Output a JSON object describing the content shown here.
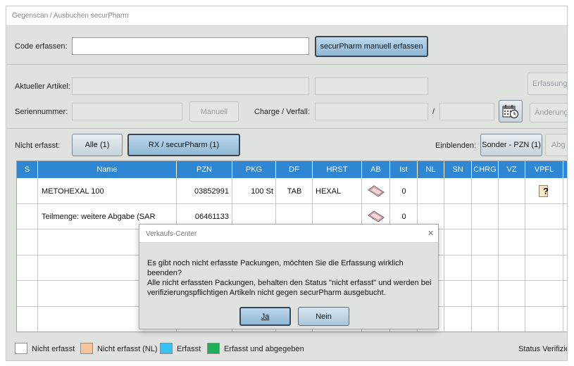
{
  "window": {
    "title": "Gegenscan / Ausbuchen securPharm"
  },
  "code": {
    "label": "Code erfassen:",
    "value": "",
    "manual_button": "securPharm manuell erfassen"
  },
  "artikel": {
    "label": "Aktueller Artikel:",
    "erfassung_button": "Erfassung"
  },
  "serien": {
    "label": "Seriennummer:",
    "manuell_button": "Manuell",
    "charge_label": "Charge / Verfall:",
    "slash": "/",
    "aenderung_button": "Änderung"
  },
  "filter": {
    "label": "Nicht erfasst:",
    "alle_button": "Alle (1)",
    "rx_button": "RX / securPharm (1)",
    "einblenden_label": "Einblenden:",
    "sonder_button": "Sonder - PZN (1)",
    "abg_button": "Abg"
  },
  "grid": {
    "columns": [
      "S",
      "Name",
      "PZN",
      "PKG",
      "DF",
      "HRST",
      "AB",
      "Ist",
      "NL",
      "SN",
      "CHRG",
      "VZ",
      "VPFL"
    ],
    "rows": [
      {
        "name": "METOHEXAL 100",
        "pzn": "03852991",
        "pkg": "100 St",
        "df": "TAB",
        "hrst": "HEXAL",
        "ist": "0",
        "vpfl": "?"
      },
      {
        "name": "Teilmenge: weitere Abgabe (SAR",
        "pzn": "06461133",
        "pkg": "",
        "df": "",
        "hrst": "",
        "ist": "0",
        "vpfl": ""
      }
    ]
  },
  "legend": [
    {
      "label": "Nicht erfasst",
      "color": "#ffffff"
    },
    {
      "label": "Nicht erfasst (NL)",
      "color": "#f6c49a"
    },
    {
      "label": "Erfasst",
      "color": "#38c2f2"
    },
    {
      "label": "Erfasst und abgegeben",
      "color": "#1fae58"
    }
  ],
  "status_label": "Status Verifizie",
  "dialog": {
    "title": "Verkaufs-Center",
    "close": "✕",
    "message_line1": "Es gibt noch nicht erfasste Packungen, möchten Sie die Erfassung wirklich beenden?",
    "message_line2": "Alle nicht erfassten Packungen, behalten den Status \"nicht erfasst\" und werden bei",
    "message_line3": "verifizierungspflichtigen Artikeln nicht gegen securPharm ausgebucht.",
    "ja_button": "Ja",
    "nein_button": "Nein"
  }
}
